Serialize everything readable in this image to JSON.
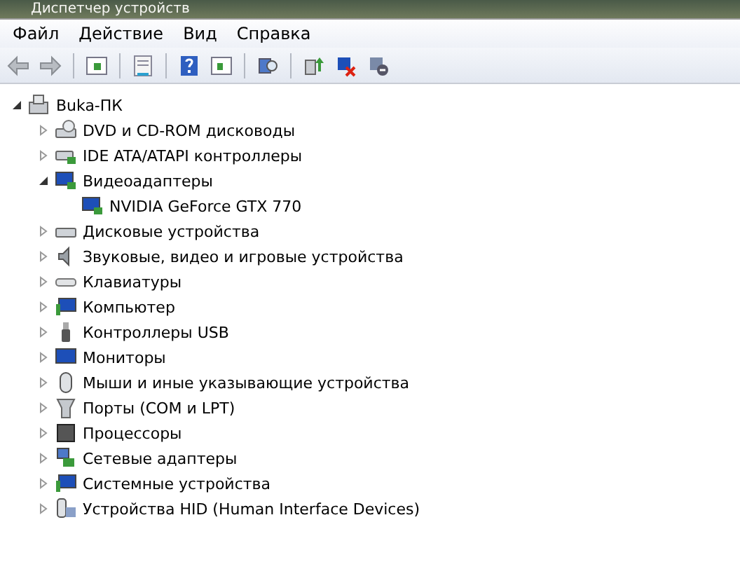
{
  "window": {
    "title": "Диспетчер устройств"
  },
  "menu": [
    "Файл",
    "Действие",
    "Вид",
    "Справка"
  ],
  "tree": {
    "label": "Buka-ПК",
    "expanded": true,
    "children": [
      {
        "label": "DVD и CD-ROM дисководы",
        "expanded": false
      },
      {
        "label": "IDE ATA/ATAPI контроллеры",
        "expanded": false
      },
      {
        "label": "Видеоадаптеры",
        "expanded": true,
        "children": [
          {
            "label": "NVIDIA GeForce GTX 770"
          }
        ]
      },
      {
        "label": "Дисковые устройства",
        "expanded": false
      },
      {
        "label": "Звуковые, видео и игровые устройства",
        "expanded": false
      },
      {
        "label": "Клавиатуры",
        "expanded": false
      },
      {
        "label": "Компьютер",
        "expanded": false
      },
      {
        "label": "Контроллеры USB",
        "expanded": false
      },
      {
        "label": "Мониторы",
        "expanded": false
      },
      {
        "label": "Мыши и иные указывающие устройства",
        "expanded": false
      },
      {
        "label": "Порты (COM и LPT)",
        "expanded": false
      },
      {
        "label": "Процессоры",
        "expanded": false
      },
      {
        "label": "Сетевые адаптеры",
        "expanded": false
      },
      {
        "label": "Системные устройства",
        "expanded": false
      },
      {
        "label": "Устройства HID (Human Interface Devices)",
        "expanded": false
      }
    ]
  }
}
